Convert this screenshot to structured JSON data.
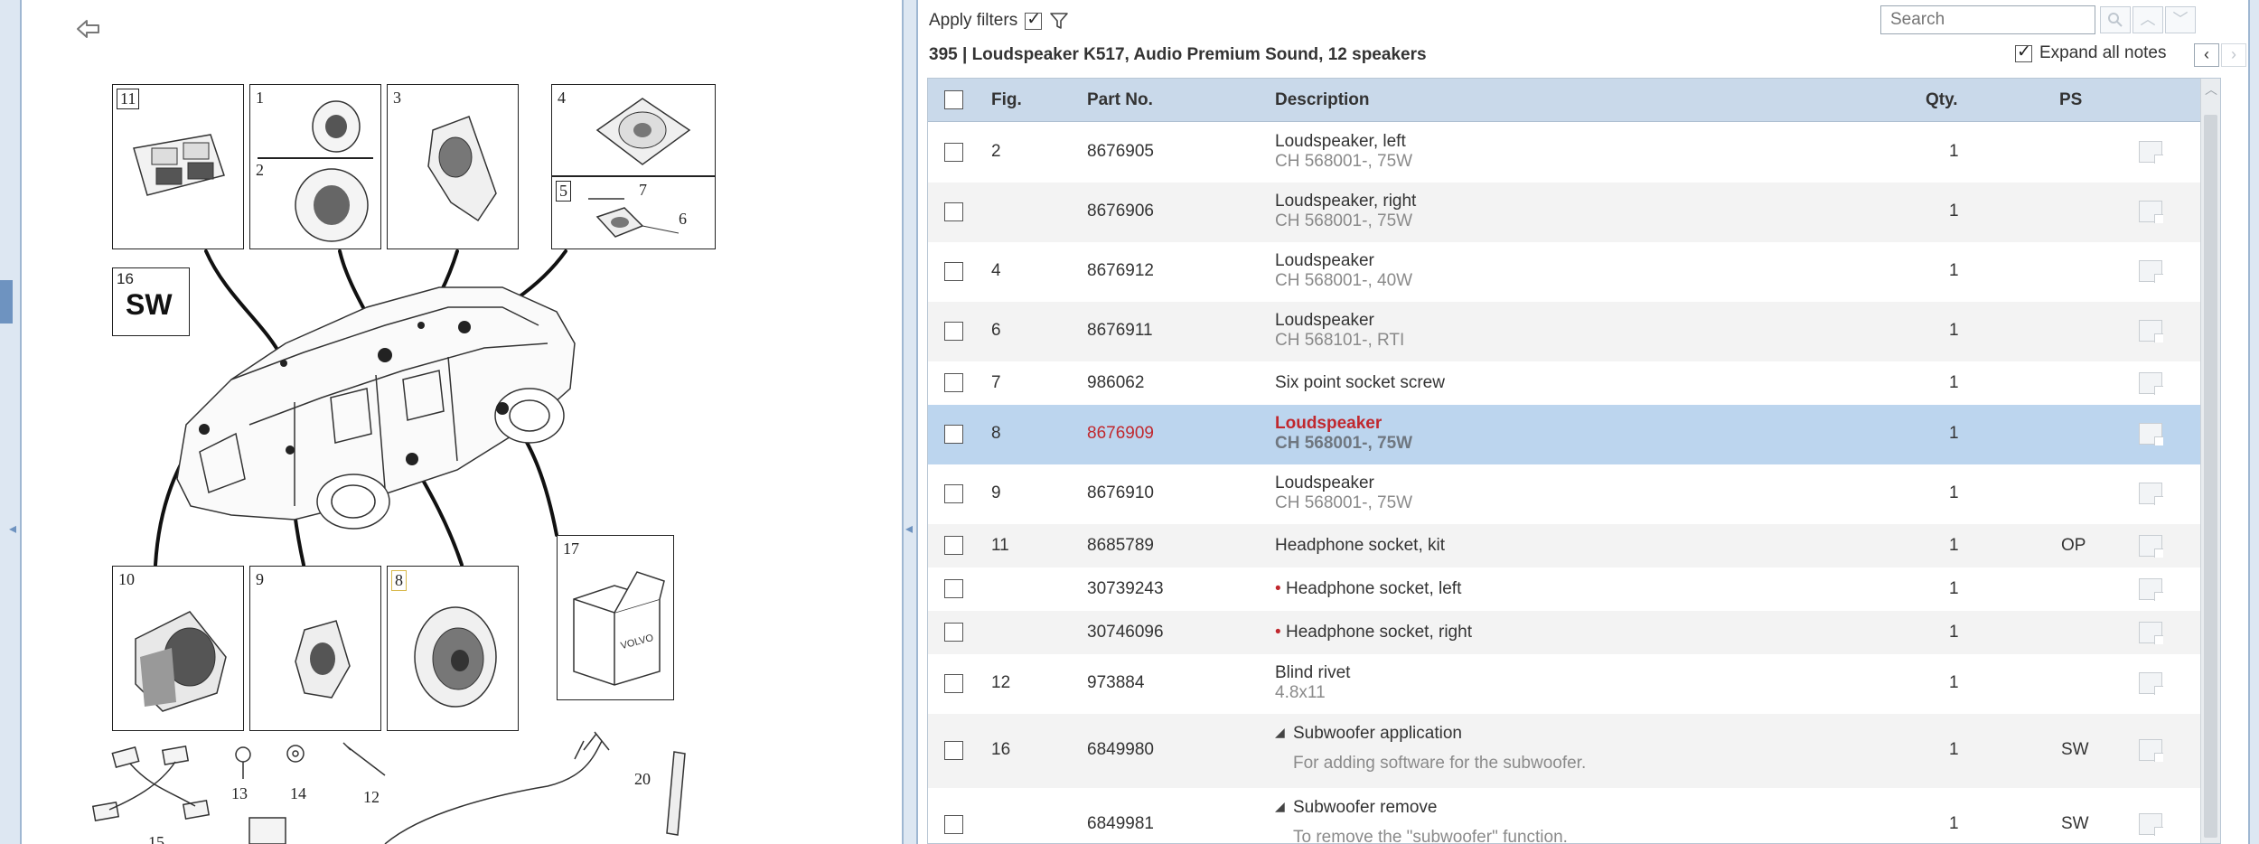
{
  "toolbar": {
    "apply_filters_label": "Apply filters",
    "apply_filters_checked": true,
    "search_placeholder": "Search"
  },
  "header": {
    "section_title": "395  |  Loudspeaker K517, Audio Premium Sound, 12 speakers",
    "expand_notes_label": "Expand all notes",
    "expand_notes_checked": true
  },
  "illustration": {
    "callouts": {
      "c11": "11",
      "c1": "1",
      "c2": "2",
      "c3": "3",
      "c4": "4",
      "c5": "5",
      "c7": "7",
      "c6": "6",
      "c16": "16",
      "c10": "10",
      "c9": "9",
      "c8": "8",
      "c17": "17",
      "c13": "13",
      "c14": "14",
      "c12": "12",
      "c20": "20",
      "c15": "15"
    },
    "sw_label": "SW",
    "box_label": "VOLVO"
  },
  "table": {
    "columns": {
      "fig": "Fig.",
      "part": "Part No.",
      "desc": "Description",
      "qty": "Qty.",
      "ps": "PS"
    },
    "rows": [
      {
        "fig": "2",
        "part": "8676905",
        "desc": "Loudspeaker, left",
        "sub": "CH 568001-, 75W",
        "qty": "1",
        "ps": ""
      },
      {
        "fig": "",
        "part": "8676906",
        "desc": "Loudspeaker, right",
        "sub": "CH 568001-, 75W",
        "qty": "1",
        "ps": ""
      },
      {
        "fig": "4",
        "part": "8676912",
        "desc": "Loudspeaker",
        "sub": "CH 568001-, 40W",
        "qty": "1",
        "ps": ""
      },
      {
        "fig": "6",
        "part": "8676911",
        "desc": "Loudspeaker",
        "sub": "CH 568101-, RTI",
        "qty": "1",
        "ps": ""
      },
      {
        "fig": "7",
        "part": "986062",
        "desc": "Six point socket screw",
        "sub": "",
        "qty": "1",
        "ps": ""
      },
      {
        "fig": "8",
        "part": "8676909",
        "desc": "Loudspeaker",
        "sub": "CH 568001-, 75W",
        "qty": "1",
        "ps": ""
      },
      {
        "fig": "9",
        "part": "8676910",
        "desc": "Loudspeaker",
        "sub": "CH 568001-, 75W",
        "qty": "1",
        "ps": ""
      },
      {
        "fig": "11",
        "part": "8685789",
        "desc": "Headphone socket, kit",
        "sub": "",
        "qty": "1",
        "ps": "OP"
      },
      {
        "fig": "",
        "part": "30739243",
        "desc": "Headphone socket, left",
        "sub": "",
        "qty": "1",
        "ps": ""
      },
      {
        "fig": "",
        "part": "30746096",
        "desc": "Headphone socket, right",
        "sub": "",
        "qty": "1",
        "ps": ""
      },
      {
        "fig": "12",
        "part": "973884",
        "desc": "Blind rivet",
        "sub": "4.8x11",
        "qty": "1",
        "ps": ""
      },
      {
        "fig": "16",
        "part": "6849980",
        "desc": "Subwoofer application",
        "sub": "For adding software for the subwoofer.",
        "qty": "1",
        "ps": "SW"
      },
      {
        "fig": "",
        "part": "6849981",
        "desc": "Subwoofer remove",
        "sub": "To remove the \"subwoofer\" function.",
        "qty": "1",
        "ps": "SW"
      }
    ]
  },
  "colors": {
    "header_bg": "#c9d9ea",
    "selected_row_bg": "#bcd5ee",
    "selected_text": "#c0282e",
    "frame": "#dde7f2"
  },
  "icons": [
    "back-arrow-icon",
    "filter-icon",
    "search-icon",
    "chevron-up-icon",
    "chevron-down-icon",
    "chevron-left-icon",
    "chevron-right-icon",
    "note-icon",
    "expand-triangle-icon"
  ]
}
